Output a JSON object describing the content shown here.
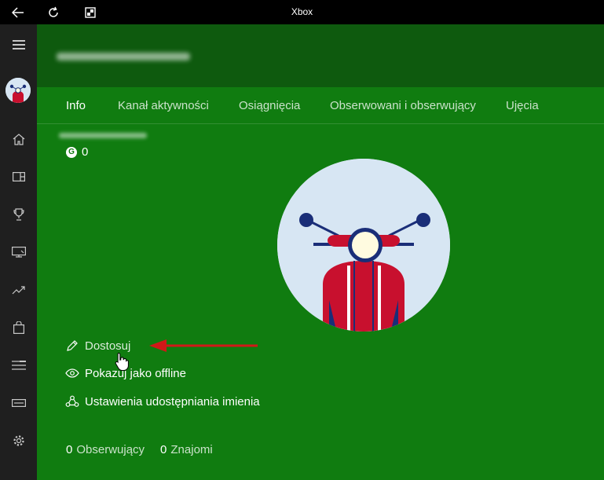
{
  "titlebar": {
    "title": "Xbox",
    "back_icon": "back-arrow-icon",
    "refresh_icon": "refresh-icon",
    "snap_icon": "window-snap-icon"
  },
  "sidebar": {
    "items": [
      "hamburger-menu-icon",
      "avatar",
      "home-icon",
      "my-games-icon",
      "achievements-trophy-icon",
      "game-dvr-icon",
      "trending-icon",
      "store-bag-icon",
      "lists-icon",
      "connection-icon",
      "settings-gear-icon"
    ]
  },
  "tabs": [
    {
      "label": "Info",
      "active": true
    },
    {
      "label": "Kanał aktywności",
      "active": false
    },
    {
      "label": "Osiągnięcia",
      "active": false
    },
    {
      "label": "Obserwowani i obserwujący",
      "active": false
    },
    {
      "label": "Ujęcia",
      "active": false
    }
  ],
  "profile": {
    "gamerscore": "0"
  },
  "actions": [
    {
      "label": "Dostosuj",
      "icon": "pencil-icon"
    },
    {
      "label": "Pokazuj jako offline",
      "icon": "eye-icon"
    },
    {
      "label": "Ustawienia udostępniania imienia",
      "icon": "people-share-icon"
    }
  ],
  "stats": {
    "followers_count": "0",
    "followers_label": "Obserwujący",
    "friends_count": "0",
    "friends_label": "Znajomi"
  },
  "colors": {
    "accent_green": "#107c10",
    "header_green": "#0e5a0e",
    "sidebar": "#1f1f1f",
    "annotation_arrow": "#d01818"
  }
}
